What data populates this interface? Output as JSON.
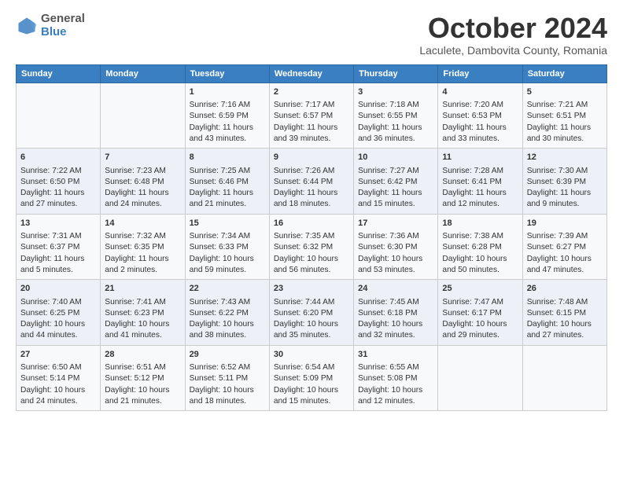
{
  "logo": {
    "general": "General",
    "blue": "Blue"
  },
  "header": {
    "month": "October 2024",
    "location": "Laculete, Dambovita County, Romania"
  },
  "days_of_week": [
    "Sunday",
    "Monday",
    "Tuesday",
    "Wednesday",
    "Thursday",
    "Friday",
    "Saturday"
  ],
  "weeks": [
    [
      {
        "day": "",
        "content": ""
      },
      {
        "day": "",
        "content": ""
      },
      {
        "day": "1",
        "content": "Sunrise: 7:16 AM\nSunset: 6:59 PM\nDaylight: 11 hours and 43 minutes."
      },
      {
        "day": "2",
        "content": "Sunrise: 7:17 AM\nSunset: 6:57 PM\nDaylight: 11 hours and 39 minutes."
      },
      {
        "day": "3",
        "content": "Sunrise: 7:18 AM\nSunset: 6:55 PM\nDaylight: 11 hours and 36 minutes."
      },
      {
        "day": "4",
        "content": "Sunrise: 7:20 AM\nSunset: 6:53 PM\nDaylight: 11 hours and 33 minutes."
      },
      {
        "day": "5",
        "content": "Sunrise: 7:21 AM\nSunset: 6:51 PM\nDaylight: 11 hours and 30 minutes."
      }
    ],
    [
      {
        "day": "6",
        "content": "Sunrise: 7:22 AM\nSunset: 6:50 PM\nDaylight: 11 hours and 27 minutes."
      },
      {
        "day": "7",
        "content": "Sunrise: 7:23 AM\nSunset: 6:48 PM\nDaylight: 11 hours and 24 minutes."
      },
      {
        "day": "8",
        "content": "Sunrise: 7:25 AM\nSunset: 6:46 PM\nDaylight: 11 hours and 21 minutes."
      },
      {
        "day": "9",
        "content": "Sunrise: 7:26 AM\nSunset: 6:44 PM\nDaylight: 11 hours and 18 minutes."
      },
      {
        "day": "10",
        "content": "Sunrise: 7:27 AM\nSunset: 6:42 PM\nDaylight: 11 hours and 15 minutes."
      },
      {
        "day": "11",
        "content": "Sunrise: 7:28 AM\nSunset: 6:41 PM\nDaylight: 11 hours and 12 minutes."
      },
      {
        "day": "12",
        "content": "Sunrise: 7:30 AM\nSunset: 6:39 PM\nDaylight: 11 hours and 9 minutes."
      }
    ],
    [
      {
        "day": "13",
        "content": "Sunrise: 7:31 AM\nSunset: 6:37 PM\nDaylight: 11 hours and 5 minutes."
      },
      {
        "day": "14",
        "content": "Sunrise: 7:32 AM\nSunset: 6:35 PM\nDaylight: 11 hours and 2 minutes."
      },
      {
        "day": "15",
        "content": "Sunrise: 7:34 AM\nSunset: 6:33 PM\nDaylight: 10 hours and 59 minutes."
      },
      {
        "day": "16",
        "content": "Sunrise: 7:35 AM\nSunset: 6:32 PM\nDaylight: 10 hours and 56 minutes."
      },
      {
        "day": "17",
        "content": "Sunrise: 7:36 AM\nSunset: 6:30 PM\nDaylight: 10 hours and 53 minutes."
      },
      {
        "day": "18",
        "content": "Sunrise: 7:38 AM\nSunset: 6:28 PM\nDaylight: 10 hours and 50 minutes."
      },
      {
        "day": "19",
        "content": "Sunrise: 7:39 AM\nSunset: 6:27 PM\nDaylight: 10 hours and 47 minutes."
      }
    ],
    [
      {
        "day": "20",
        "content": "Sunrise: 7:40 AM\nSunset: 6:25 PM\nDaylight: 10 hours and 44 minutes."
      },
      {
        "day": "21",
        "content": "Sunrise: 7:41 AM\nSunset: 6:23 PM\nDaylight: 10 hours and 41 minutes."
      },
      {
        "day": "22",
        "content": "Sunrise: 7:43 AM\nSunset: 6:22 PM\nDaylight: 10 hours and 38 minutes."
      },
      {
        "day": "23",
        "content": "Sunrise: 7:44 AM\nSunset: 6:20 PM\nDaylight: 10 hours and 35 minutes."
      },
      {
        "day": "24",
        "content": "Sunrise: 7:45 AM\nSunset: 6:18 PM\nDaylight: 10 hours and 32 minutes."
      },
      {
        "day": "25",
        "content": "Sunrise: 7:47 AM\nSunset: 6:17 PM\nDaylight: 10 hours and 29 minutes."
      },
      {
        "day": "26",
        "content": "Sunrise: 7:48 AM\nSunset: 6:15 PM\nDaylight: 10 hours and 27 minutes."
      }
    ],
    [
      {
        "day": "27",
        "content": "Sunrise: 6:50 AM\nSunset: 5:14 PM\nDaylight: 10 hours and 24 minutes."
      },
      {
        "day": "28",
        "content": "Sunrise: 6:51 AM\nSunset: 5:12 PM\nDaylight: 10 hours and 21 minutes."
      },
      {
        "day": "29",
        "content": "Sunrise: 6:52 AM\nSunset: 5:11 PM\nDaylight: 10 hours and 18 minutes."
      },
      {
        "day": "30",
        "content": "Sunrise: 6:54 AM\nSunset: 5:09 PM\nDaylight: 10 hours and 15 minutes."
      },
      {
        "day": "31",
        "content": "Sunrise: 6:55 AM\nSunset: 5:08 PM\nDaylight: 10 hours and 12 minutes."
      },
      {
        "day": "",
        "content": ""
      },
      {
        "day": "",
        "content": ""
      }
    ]
  ]
}
